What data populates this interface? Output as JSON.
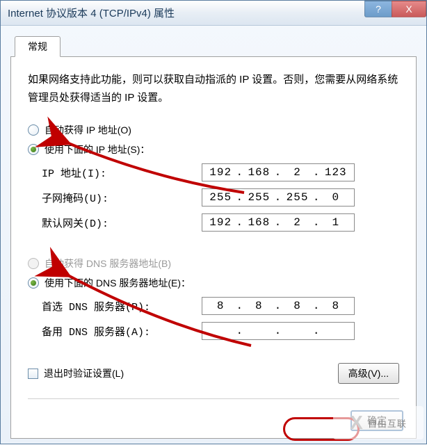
{
  "window": {
    "title": "Internet 协议版本 4 (TCP/IPv4) 属性",
    "help": "?",
    "close": "X"
  },
  "tab": {
    "label": "常规"
  },
  "intro": "如果网络支持此功能，则可以获取自动指派的 IP 设置。否则，您需要从网络系统管理员处获得适当的 IP 设置。",
  "ip": {
    "auto_label": "自动获得 IP 地址(O)",
    "manual_label": "使用下面的 IP 地址(S)：",
    "addr_label": "IP 地址(I):",
    "mask_label": "子网掩码(U):",
    "gw_label": "默认网关(D):",
    "addr": {
      "o1": "192",
      "o2": "168",
      "o3": "2",
      "o4": "123"
    },
    "mask": {
      "o1": "255",
      "o2": "255",
      "o3": "255",
      "o4": "0"
    },
    "gw": {
      "o1": "192",
      "o2": "168",
      "o3": "2",
      "o4": "1"
    }
  },
  "dns": {
    "auto_label": "自动获得 DNS 服务器地址(B)",
    "manual_label": "使用下面的 DNS 服务器地址(E)：",
    "pref_label": "首选 DNS 服务器(P):",
    "alt_label": "备用 DNS 服务器(A):",
    "pref": {
      "o1": "8",
      "o2": "8",
      "o3": "8",
      "o4": "8"
    },
    "alt": {
      "o1": "",
      "o2": "",
      "o3": "",
      "o4": ""
    }
  },
  "validate_label": "退出时验证设置(L)",
  "advanced_label": "高级(V)...",
  "ok_label": "确定",
  "watermark": "自由互联"
}
